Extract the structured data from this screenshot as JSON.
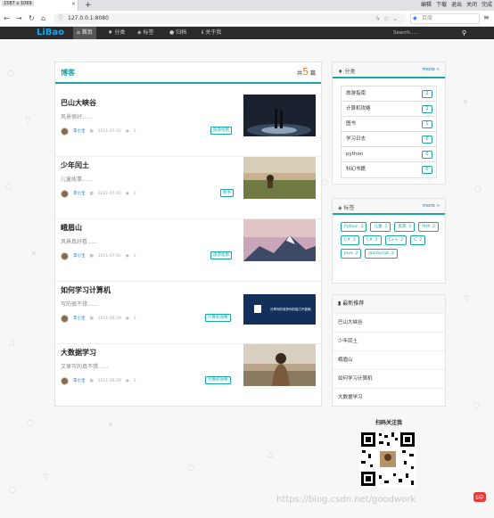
{
  "browser": {
    "tab_title": "1587 x 1069",
    "address": "127.0.0.1:8080",
    "search_engine": "百度",
    "window_buttons": [
      "编辑",
      "下载",
      "退出",
      "关闭",
      "完成"
    ]
  },
  "site": {
    "brand": "LiBao",
    "nav": [
      {
        "icon": "home-icon",
        "label": "首页",
        "active": true
      },
      {
        "icon": "bulb-icon",
        "label": "分类",
        "active": false
      },
      {
        "icon": "tag-icon",
        "label": "标签",
        "active": false
      },
      {
        "icon": "archive-icon",
        "label": "归档",
        "active": false
      },
      {
        "icon": "info-icon",
        "label": "关于我",
        "active": false
      }
    ],
    "search_placeholder": "Search......"
  },
  "main": {
    "title": "博客",
    "count_prefix": "共",
    "count": "5",
    "count_suffix": "篇",
    "posts": [
      {
        "title": "巴山大峡谷",
        "excerpt": "风景很好......",
        "author": "李小宝",
        "date": "2021-07-01",
        "views": "2",
        "tag": "旅游指南",
        "thumb": "night"
      },
      {
        "title": "少年闰土",
        "excerpt": "儿童故事......",
        "author": "李小宝",
        "date": "2021-07-01",
        "views": "2",
        "tag": "图书",
        "thumb": "field"
      },
      {
        "title": "峨眉山",
        "excerpt": "风景真好看......",
        "author": "李小宝",
        "date": "2021-07-01",
        "views": "2",
        "tag": "旅游指南",
        "thumb": "mountain"
      },
      {
        "title": "如何学习计算机",
        "excerpt": "写的很不错......",
        "author": "李小宝",
        "date": "2021-06-29",
        "views": "2",
        "tag": "计算机攻略",
        "thumb": "slide"
      },
      {
        "title": "大数据学习",
        "excerpt": "文章写的真不错......",
        "author": "李小宝",
        "date": "2021-06-29",
        "views": "2",
        "tag": "计算机攻略",
        "thumb": "person"
      }
    ],
    "slide_text": "分享你的收获你的能力不能输"
  },
  "sidebar": {
    "categories": {
      "title": "分类",
      "more": "more",
      "items": [
        {
          "label": "旅游指南",
          "count": "2"
        },
        {
          "label": "计算机攻略",
          "count": "2"
        },
        {
          "label": "图书",
          "count": "1"
        },
        {
          "label": "学习日志",
          "count": "0"
        },
        {
          "label": "python",
          "count": "0"
        },
        {
          "label": "科幻书籍",
          "count": "0"
        }
      ]
    },
    "tags": {
      "title": "标签",
      "more": "more",
      "items": [
        {
          "label": "Python",
          "count": "2"
        },
        {
          "label": "儿童",
          "count": "1"
        },
        {
          "label": "旅游",
          "count": "2"
        },
        {
          "label": "PHP",
          "count": "2"
        },
        {
          "label": "C#",
          "count": "2"
        },
        {
          "label": "C#",
          "count": "2"
        },
        {
          "label": "C++",
          "count": "2"
        },
        {
          "label": "C",
          "count": "2"
        },
        {
          "label": "Java",
          "count": "2"
        },
        {
          "label": "JavaScript",
          "count": "2"
        }
      ]
    },
    "recommend": {
      "title": "最新推荐",
      "items": [
        "巴山大峡谷",
        "少年闰土",
        "峨眉山",
        "如何学习计算机",
        "大数据学习"
      ]
    },
    "qr_title": "扫码关注我"
  },
  "watermark": "https://blog.csdn.net/goodwork",
  "corner_logo": "S中",
  "colors": {
    "accent": "#1aa6a6",
    "link": "#1a73c4",
    "count": "#e37a2b",
    "navbar": "#2a2a2a"
  }
}
